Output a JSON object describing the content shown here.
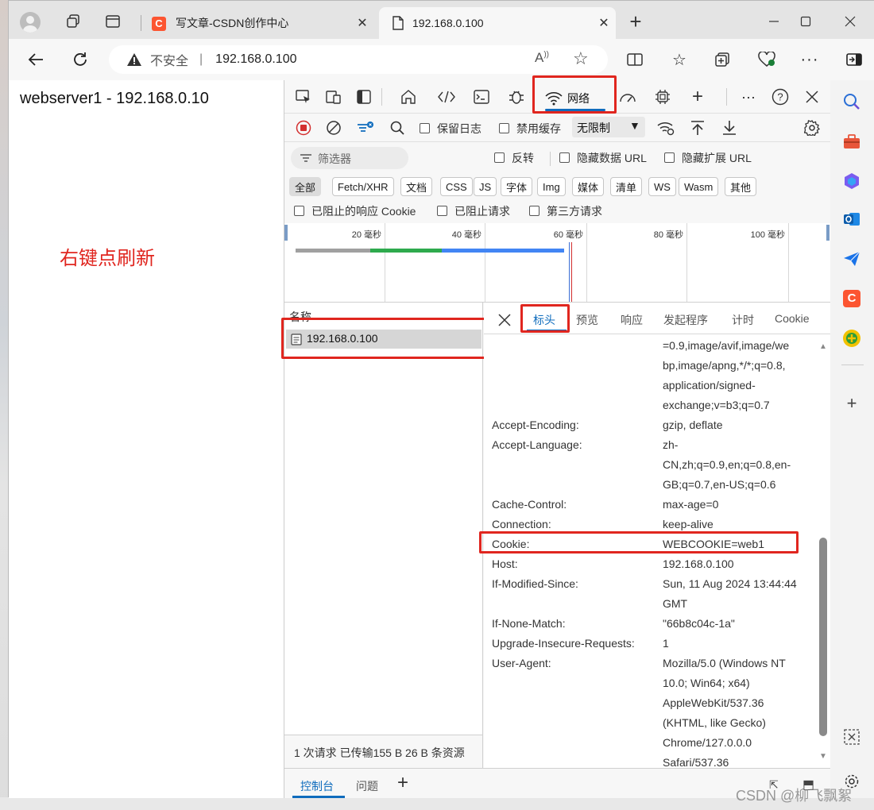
{
  "tabs": [
    {
      "title": "写文章-CSDN创作中心",
      "icon_text": "C",
      "active": false
    },
    {
      "title": "192.168.0.100",
      "active": true
    }
  ],
  "address": {
    "security": "不安全",
    "separator": "|",
    "url": "192.168.0.100"
  },
  "page": {
    "heading": "webserver1 - 192.168.0.10",
    "annotation": "右键点刷新"
  },
  "devtools": {
    "network_tab_label": "网络",
    "toolbar": {
      "preserve_log": "保留日志",
      "disable_cache": "禁用缓存",
      "throttle": "无限制"
    },
    "filter": {
      "placeholder": "筛选器",
      "invert": "反转",
      "hide_data_url": "隐藏数据 URL",
      "hide_ext_url": "隐藏扩展 URL"
    },
    "type_filters": [
      "全部",
      "Fetch/XHR",
      "文档",
      "CSS",
      "JS",
      "字体",
      "Img",
      "媒体",
      "清单",
      "WS",
      "Wasm",
      "其他"
    ],
    "options": {
      "blocked_cookie": "已阻止的响应 Cookie",
      "blocked_requests": "已阻止请求",
      "third_party": "第三方请求"
    },
    "timeline": {
      "ticks": [
        "20 毫秒",
        "40 毫秒",
        "60 毫秒",
        "80 毫秒",
        "100 毫秒"
      ]
    },
    "list": {
      "name_header": "名称",
      "request": "192.168.0.100"
    },
    "status": "1 次请求  已传输155 B  26 B 条资源",
    "detail_tabs": [
      "标头",
      "预览",
      "响应",
      "发起程序",
      "计时",
      "Cookie"
    ],
    "headers_top": [
      "=0.9,image/avif,image/we",
      "bp,image/apng,*/*;q=0.8,",
      "application/signed-",
      "exchange;v=b3;q=0.7"
    ],
    "headers": [
      {
        "key": "Accept-Encoding:",
        "lines": [
          "gzip, deflate"
        ]
      },
      {
        "key": "Accept-Language:",
        "lines": [
          "zh-",
          "CN,zh;q=0.9,en;q=0.8,en-",
          "GB;q=0.7,en-US;q=0.6"
        ]
      },
      {
        "key": "Cache-Control:",
        "lines": [
          "max-age=0"
        ]
      },
      {
        "key": "Connection:",
        "lines": [
          "keep-alive"
        ]
      },
      {
        "key": "Cookie:",
        "lines": [
          "WEBCOOKIE=web1"
        ]
      },
      {
        "key": "Host:",
        "lines": [
          "192.168.0.100"
        ]
      },
      {
        "key": "If-Modified-Since:",
        "lines": [
          "Sun, 11 Aug 2024 13:44:44",
          "GMT"
        ]
      },
      {
        "key": "If-None-Match:",
        "lines": [
          "\"66b8c04c-1a\""
        ]
      },
      {
        "key": "Upgrade-Insecure-Requests:",
        "lines": [
          "1"
        ]
      },
      {
        "key": "User-Agent:",
        "lines": [
          "Mozilla/5.0 (Windows NT",
          "10.0; Win64; x64)",
          "AppleWebKit/537.36",
          "(KHTML, like Gecko)",
          "Chrome/127.0.0.0",
          "Safari/537.36"
        ]
      }
    ],
    "drawer_tabs": [
      "控制台",
      "问题"
    ]
  },
  "watermark": "CSDN @柳飞飘絮",
  "colors": {
    "accent": "#0f6cbd",
    "highlight": "#e0261f",
    "csdn": "#fc5531"
  }
}
